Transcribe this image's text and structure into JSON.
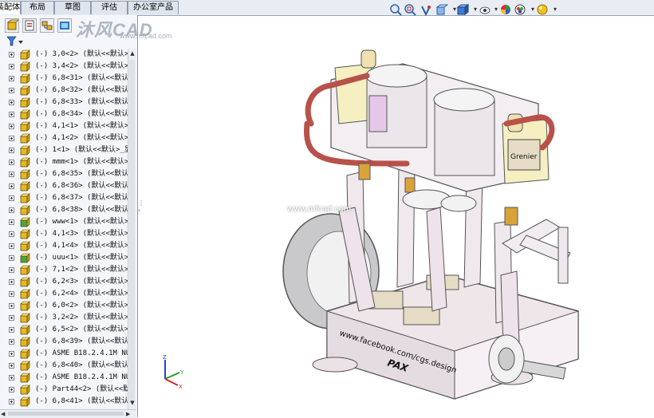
{
  "tabs": [
    "装配体",
    "布局",
    "草图",
    "评估",
    "办公室产品"
  ],
  "active_tab": 0,
  "watermark": {
    "brand": "沐风CAD",
    "url": "www.mfcad.com"
  },
  "center_watermark": "www.mfcad.com",
  "model_text": {
    "facebook": "www.facebook.com/cgs.design",
    "pax": "PAX",
    "plate": "Grenier"
  },
  "tree": [
    {
      "state": "(-)",
      "name": "3,0<2>",
      "config": "(默认<<默认>"
    },
    {
      "state": "(-)",
      "name": "3,4<2>",
      "config": "(默认<<默认>"
    },
    {
      "state": "(-)",
      "name": "6,8<31>",
      "config": "(默认<<默认"
    },
    {
      "state": "(-)",
      "name": "6,8<32>",
      "config": "(默认<<默认"
    },
    {
      "state": "(-)",
      "name": "6,8<33>",
      "config": "(默认<<默认"
    },
    {
      "state": "(-)",
      "name": "6,8<34>",
      "config": "(默认<<默认"
    },
    {
      "state": "(-)",
      "name": "4,1<1>",
      "config": "(默认<<默认>"
    },
    {
      "state": "(-)",
      "name": "4,1<2>",
      "config": "(默认<<默认>"
    },
    {
      "state": "(-)",
      "name": "1<1>",
      "config": "(默认<<默认>_显"
    },
    {
      "state": "(-)",
      "name": "mmm<1>",
      "config": "(默认<<默认>"
    },
    {
      "state": "(-)",
      "name": "6,8<35>",
      "config": "(默认<<默认"
    },
    {
      "state": "(-)",
      "name": "6,8<36>",
      "config": "(默认<<默认"
    },
    {
      "state": "(-)",
      "name": "6,8<37>",
      "config": "(默认<<默认"
    },
    {
      "state": "(-)",
      "name": "6,8<38>",
      "config": "(默认<<默认"
    },
    {
      "state": "(-)",
      "name": "www<1>",
      "config": "(默认<<默认>"
    },
    {
      "state": "(-)",
      "name": "4,1<3>",
      "config": "(默认<<默认>"
    },
    {
      "state": "(-)",
      "name": "4,1<4>",
      "config": "(默认<<默认>"
    },
    {
      "state": "(-)",
      "name": "uuu<1>",
      "config": "(默认<<默认>"
    },
    {
      "state": "(-)",
      "name": "7,1<2>",
      "config": "(默认<<默认>"
    },
    {
      "state": "(-)",
      "name": "6,2<3>",
      "config": "(默认<<默认>"
    },
    {
      "state": "(-)",
      "name": "6,2<4>",
      "config": "(默认<<默认>"
    },
    {
      "state": "(-)",
      "name": "6,0<2>",
      "config": "(默认<<默认>"
    },
    {
      "state": "(-)",
      "name": "3,2<2>",
      "config": "(默认<<默认>"
    },
    {
      "state": "(-)",
      "name": "6,5<2>",
      "config": "(默认<<默认>"
    },
    {
      "state": "(-)",
      "name": "6,8<39>",
      "config": "(默认<<默认"
    },
    {
      "state": "(-)",
      "name": "ASME B18.2.4.1M NUT",
      "config": ""
    },
    {
      "state": "(-)",
      "name": "6,8<40>",
      "config": "(默认<<默认"
    },
    {
      "state": "(-)",
      "name": "ASME B18.2.4.1M NUT",
      "config": ""
    },
    {
      "state": "(-)",
      "name": "Part44<2>",
      "config": "(默认<<默"
    },
    {
      "state": "(-)",
      "name": "6,8<41>",
      "config": "(默认<<默认"
    }
  ],
  "icon_kinds": [
    "part",
    "part",
    "part",
    "part",
    "part",
    "part",
    "part",
    "part",
    "part",
    "part",
    "part",
    "part",
    "part",
    "part",
    "assembly",
    "part",
    "part",
    "assembly",
    "part",
    "part",
    "part",
    "part",
    "part",
    "part",
    "part",
    "part",
    "part",
    "part",
    "part",
    "part"
  ],
  "colors": {
    "part_icon": "#e8b820",
    "assembly_icon": "#46a83c",
    "tab_bg": "#dfe5ee",
    "tree_bg": "#f4f6f9"
  }
}
